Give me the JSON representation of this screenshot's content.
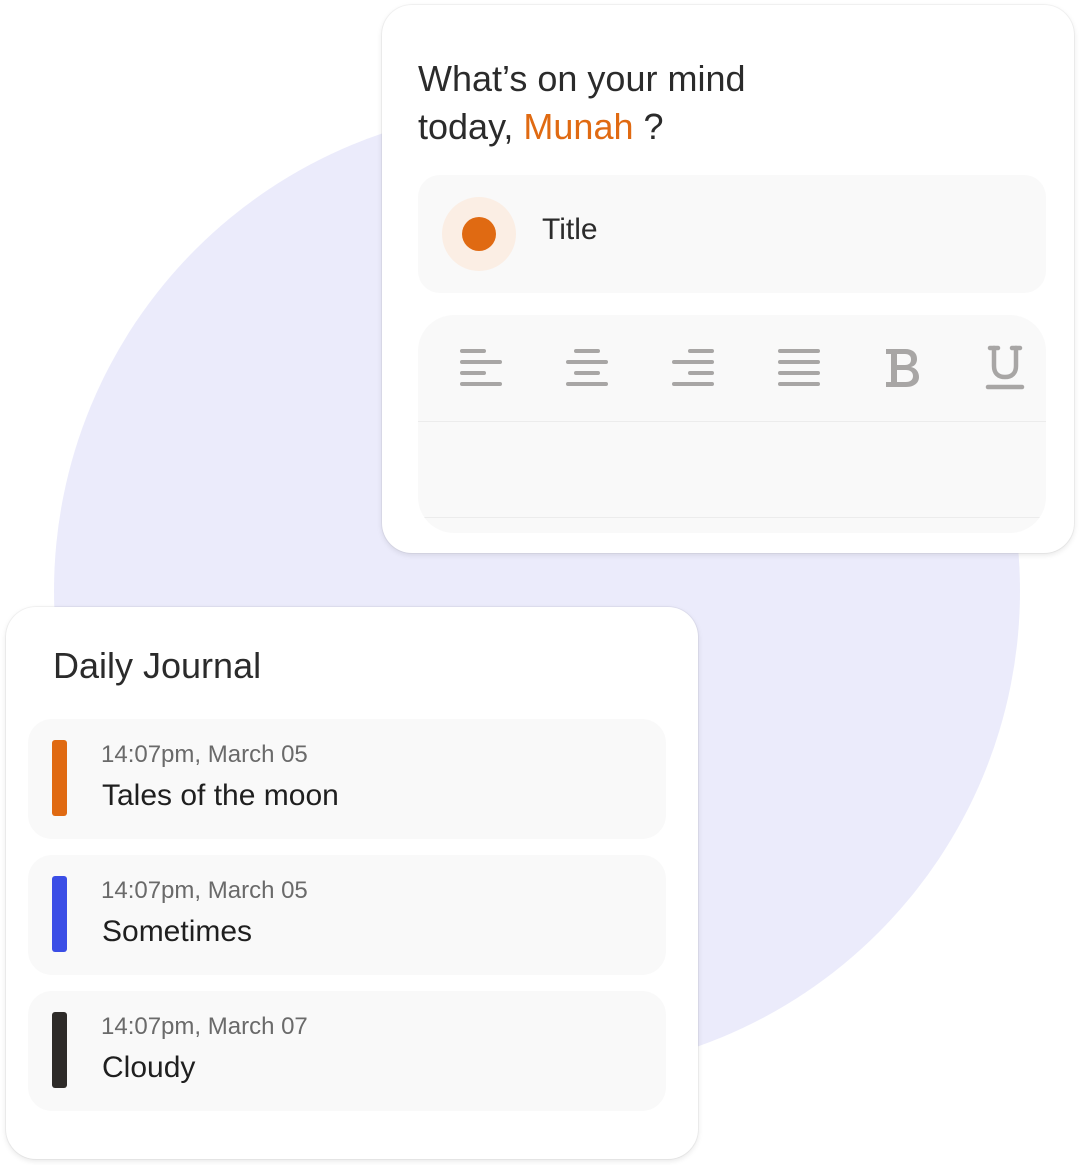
{
  "editor": {
    "prompt_line1": "What’s on your mind",
    "prompt_line2_prefix": "today, ",
    "user_name": "Munah",
    "prompt_suffix": " ?",
    "title_placeholder": "Title",
    "accent_color": "#e06a12",
    "toolbar": [
      {
        "name": "align-left-icon"
      },
      {
        "name": "align-center-icon"
      },
      {
        "name": "align-right-icon"
      },
      {
        "name": "align-justify-icon"
      },
      {
        "name": "bold-icon"
      },
      {
        "name": "underline-icon"
      }
    ],
    "body_text": ""
  },
  "journal": {
    "title": "Daily Journal",
    "entries": [
      {
        "time": "14:07pm, March 05",
        "title": "Tales of the moon",
        "color": "#e06a12"
      },
      {
        "time": "14:07pm, March 05",
        "title": "Sometimes",
        "color": "#3b4ee6"
      },
      {
        "time": "14:07pm, March 07",
        "title": "Cloudy",
        "color": "#2e2b29"
      }
    ]
  }
}
